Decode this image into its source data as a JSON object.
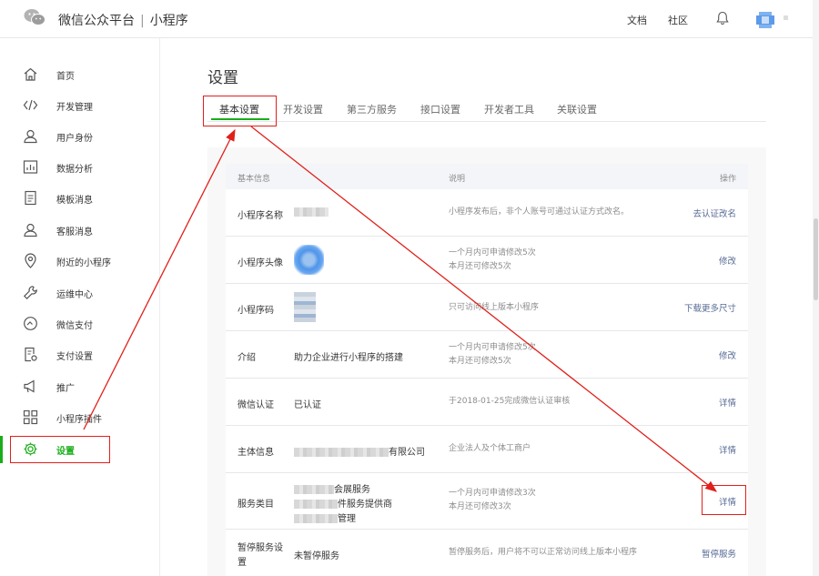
{
  "header": {
    "brand": "微信公众平台",
    "separator": "|",
    "product": "小程序",
    "links": [
      "文档",
      "社区"
    ]
  },
  "sidebar": {
    "items": [
      {
        "label": "首页",
        "icon": "home-icon"
      },
      {
        "label": "开发管理",
        "icon": "code-icon"
      },
      {
        "label": "用户身份",
        "icon": "user-icon"
      },
      {
        "label": "数据分析",
        "icon": "chart-icon"
      },
      {
        "label": "模板消息",
        "icon": "document-icon"
      },
      {
        "label": "客服消息",
        "icon": "customer-service-icon"
      },
      {
        "label": "附近的小程序",
        "icon": "location-pin-icon"
      },
      {
        "label": "运维中心",
        "icon": "wrench-icon"
      },
      {
        "label": "微信支付",
        "icon": "clock-icon"
      },
      {
        "label": "支付设置",
        "icon": "payment-settings-icon"
      },
      {
        "label": "推广",
        "icon": "megaphone-icon"
      },
      {
        "label": "小程序插件",
        "icon": "plugin-grid-icon"
      },
      {
        "label": "设置",
        "icon": "gear-icon",
        "active": true
      }
    ]
  },
  "main": {
    "title": "设置",
    "tabs": [
      "基本设置",
      "开发设置",
      "第三方服务",
      "接口设置",
      "开发者工具",
      "关联设置"
    ],
    "table": {
      "headers": [
        "基本信息",
        "说明",
        "操作"
      ],
      "rows": [
        {
          "label": "小程序名称",
          "value": "",
          "desc": [
            "小程序发布后，非个人账号可通过认证方式改名。"
          ],
          "op": "去认证改名"
        },
        {
          "label": "小程序头像",
          "value": "",
          "desc": [
            "一个月内可申请修改5次",
            "本月还可修改5次"
          ],
          "op": "修改"
        },
        {
          "label": "小程序码",
          "value": "",
          "desc": [
            "只可访问线上版本小程序"
          ],
          "op": "下载更多尺寸"
        },
        {
          "label": "介绍",
          "value": "助力企业进行小程序的搭建",
          "desc": [
            "一个月内可申请修改5次",
            "本月还可修改5次"
          ],
          "op": "修改"
        },
        {
          "label": "微信认证",
          "value": "已认证",
          "desc": [
            "于2018-01-25完成微信认证审核"
          ],
          "op": "详情"
        },
        {
          "label": "主体信息",
          "value": "有限公司",
          "desc": [
            "企业法人及个体工商户"
          ],
          "op": "详情"
        },
        {
          "label": "服务类目",
          "values": [
            "会展服务",
            "件服务提供商",
            "管理"
          ],
          "desc": [
            "一个月内可申请修改3次",
            "本月还可修改3次"
          ],
          "op": "详情"
        },
        {
          "label": "暂停服务设置",
          "value": "未暂停服务",
          "desc": [
            "暂停服务后，用户将不可以正常访问线上版本小程序"
          ],
          "op": "暂停服务"
        }
      ]
    }
  },
  "colors": {
    "accent": "#1aad19",
    "link": "#576b95",
    "annotation": "#e0201a"
  }
}
